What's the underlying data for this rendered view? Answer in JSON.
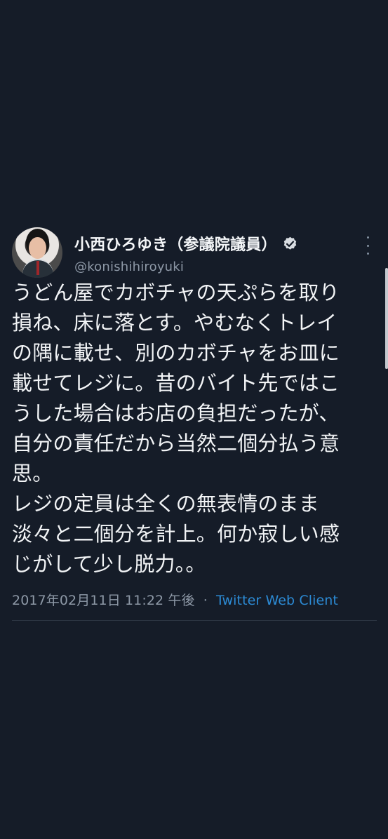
{
  "tweet": {
    "display_name": "小西ひろゆき（参議院議員）",
    "handle": "@konishihiroyuki",
    "text": "うどん屋でカボチャの天ぷらを取り\n損ね、床に落とす。やむなくトレイ\nの隅に載せ、別のカボチャをお皿に\n載せてレジに。昔のバイト先ではこ\nうした場合はお店の負担だったが、\n自分の責任だから当然二個分払う意\n思。\nレジの定員は全くの無表情のまま\n淡々と二個分を計上。何か寂しい感\nじがして少し脱力。。",
    "date_time": "2017年02月11日 11:22 午後",
    "separator": "·",
    "source": "Twitter Web Client",
    "verified_icon": "verified-badge-icon",
    "more_icon": "vertical-ellipsis-icon"
  },
  "colors": {
    "background": "#151c28",
    "text": "#f2f4f6",
    "muted": "#8d98a6",
    "link": "#2c8bd5"
  }
}
